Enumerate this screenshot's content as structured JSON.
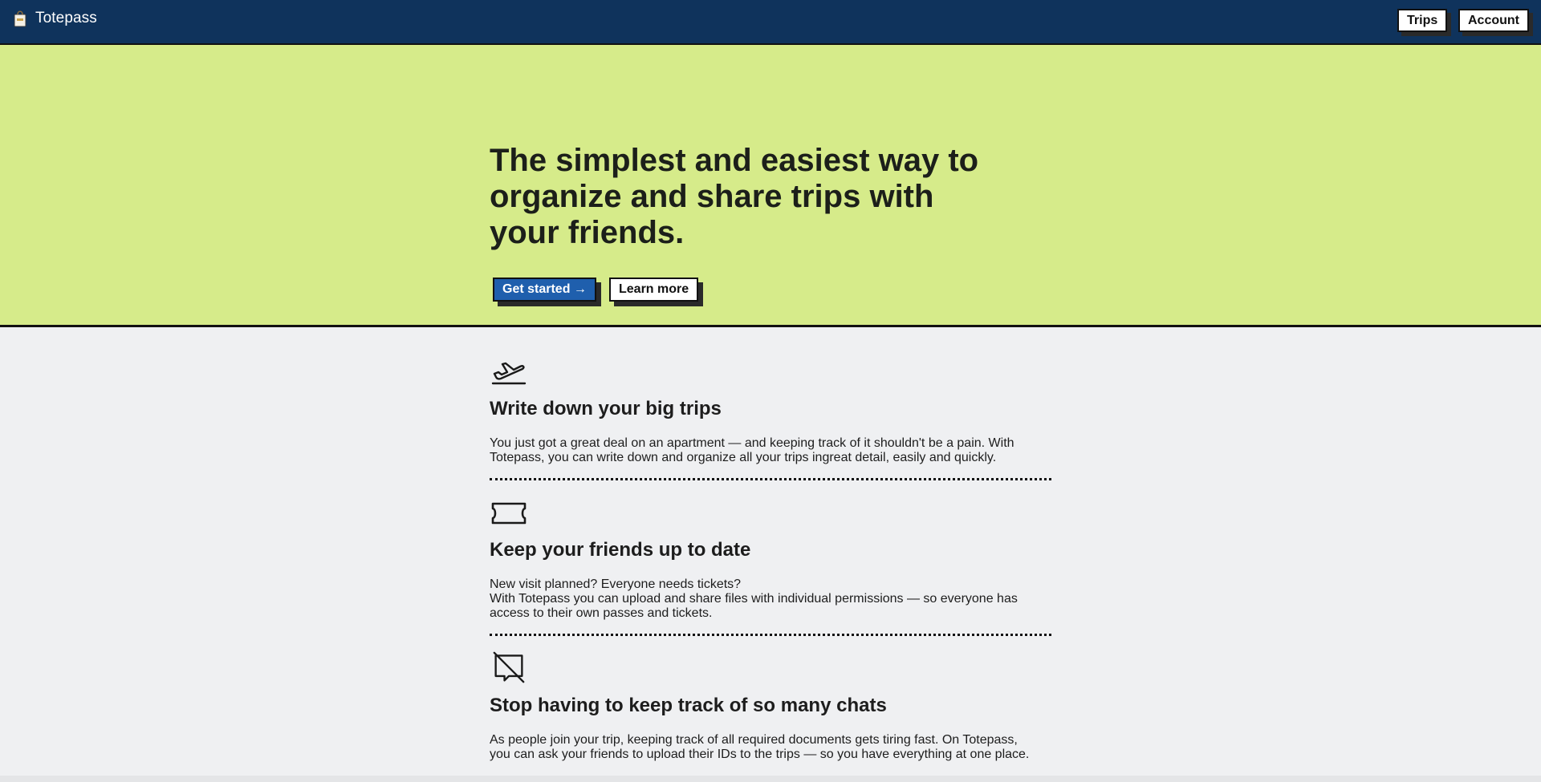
{
  "header": {
    "app_name": "Totepass",
    "logo_icon": "tote-bag-icon",
    "nav": {
      "trips_label": "Trips",
      "account_label": "Account"
    }
  },
  "hero": {
    "title": "The simplest and easiest way to organize and share trips with your friends.",
    "primary_cta": "Get started →",
    "secondary_cta": "Learn more"
  },
  "features": [
    {
      "icon": "airplane-takeoff-icon",
      "title": "Write down your big trips",
      "lines": [
        "You just got a great deal on an apartment — and keeping track of it shouldn't be a pain. With",
        "Totepass, you can write down and organize all your trips ingreat detail, easily and quickly."
      ]
    },
    {
      "icon": "ticket-icon",
      "title": "Keep your friends up to date",
      "lines": [
        "New visit planned? Everyone needs tickets?",
        "With Totepass you can upload and share files with individual permissions — so everyone has",
        "access to their own passes and tickets."
      ]
    },
    {
      "icon": "chat-off-icon",
      "title": "Stop having to keep track of so many chats",
      "lines": [
        "As people join your trip, keeping track of all required documents gets tiring fast. On Totepass,",
        "you can ask your friends to upload their IDs to the trips — so you have everything at one place."
      ]
    }
  ],
  "colors": {
    "header_bg": "#0f335c",
    "hero_bg": "#d6eb8a",
    "primary_button": "#1f5fad",
    "page_bg": "#eff0f2"
  }
}
